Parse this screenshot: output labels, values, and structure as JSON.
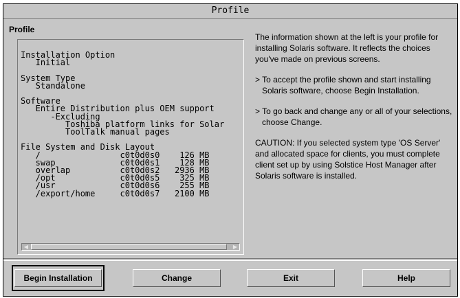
{
  "window": {
    "title": "Profile"
  },
  "profile_section": {
    "label": "Profile",
    "text": "Installation Option\n   Initial\n\nSystem Type\n   Standalone\n\nSoftware\n   Entire Distribution plus OEM support\n      -Excluding\n         Toshiba platform links for Solar\n         ToolTalk manual pages\n\nFile System and Disk Layout\n   /                c0t0d0s0    126 MB\n   swap             c0t0d0s1    128 MB\n   overlap          c0t0d0s2   2936 MB\n   /opt             c0t0d0s5    325 MB\n   /usr             c0t0d0s6    255 MB\n   /export/home     c0t0d0s7   2100 MB"
  },
  "info": {
    "paragraph1": "The information shown at the left is your profile for installing Solaris software. It reflects the choices you've made on previous screens.",
    "paragraph2": "> To accept the profile shown and start installing Solaris software, choose Begin Installation.",
    "paragraph3": "> To go back and change any or all of your selections, choose Change.",
    "paragraph4": "CAUTION: If you selected system type 'OS Server' and allocated space for clients, you must complete client set up by using Solstice Host Manager after Solaris software is installed."
  },
  "buttons": {
    "begin_installation": "Begin Installation",
    "change": "Change",
    "exit": "Exit",
    "help": "Help"
  }
}
